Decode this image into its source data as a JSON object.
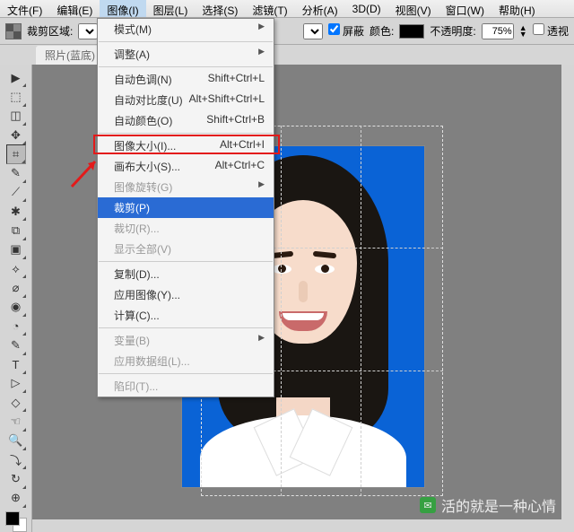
{
  "menubar": [
    "文件(F)",
    "编辑(E)",
    "图像(I)",
    "图层(L)",
    "选择(S)",
    "滤镜(T)",
    "分析(A)",
    "3D(D)",
    "视图(V)",
    "窗口(W)",
    "帮助(H)"
  ],
  "activeMenuIndex": 2,
  "opt": {
    "cropLabel": "裁剪区域:",
    "shieldChk": "屏蔽",
    "colorLbl": "颜色:",
    "opacityLbl": "不透明度:",
    "opacityVal": "75%",
    "perspective": "透视"
  },
  "tab": {
    "title": "照片(蓝底)",
    "close": "✕"
  },
  "imageMenu": {
    "groups": [
      [
        {
          "l": "模式(M)",
          "sc": "",
          "sub": true,
          "dim": false
        }
      ],
      [
        {
          "l": "调整(A)",
          "sc": "",
          "sub": true,
          "dim": false
        }
      ],
      [
        {
          "l": "自动色调(N)",
          "sc": "Shift+Ctrl+L"
        },
        {
          "l": "自动对比度(U)",
          "sc": "Alt+Shift+Ctrl+L"
        },
        {
          "l": "自动颜色(O)",
          "sc": "Shift+Ctrl+B"
        }
      ],
      [
        {
          "l": "图像大小(I)...",
          "sc": "Alt+Ctrl+I"
        },
        {
          "l": "画布大小(S)...",
          "sc": "Alt+Ctrl+C"
        },
        {
          "l": "图像旋转(G)",
          "sc": "",
          "sub": true,
          "dim": true
        },
        {
          "l": "裁剪(P)",
          "sc": "",
          "hl": true
        },
        {
          "l": "裁切(R)...",
          "sc": "",
          "dim": true
        },
        {
          "l": "显示全部(V)",
          "sc": "",
          "dim": true
        }
      ],
      [
        {
          "l": "复制(D)...",
          "sc": ""
        },
        {
          "l": "应用图像(Y)...",
          "sc": ""
        },
        {
          "l": "计算(C)...",
          "sc": ""
        }
      ],
      [
        {
          "l": "变量(B)",
          "sc": "",
          "sub": true,
          "dim": true
        },
        {
          "l": "应用数据组(L)...",
          "sc": "",
          "dim": true
        }
      ],
      [
        {
          "l": "陷印(T)...",
          "sc": "",
          "dim": true
        }
      ]
    ]
  },
  "tools": [
    "▶",
    "⬚",
    "◫",
    "✥",
    "⌗",
    "✎",
    "⟋",
    "✱",
    "⧉",
    "▣",
    "⟡",
    "⌀",
    "◉",
    "◔",
    "✎",
    "T",
    "▷",
    "◇",
    "☜",
    "🔍",
    "⤵",
    "↻",
    "⊕"
  ],
  "watermark": "活的就是一种心情"
}
